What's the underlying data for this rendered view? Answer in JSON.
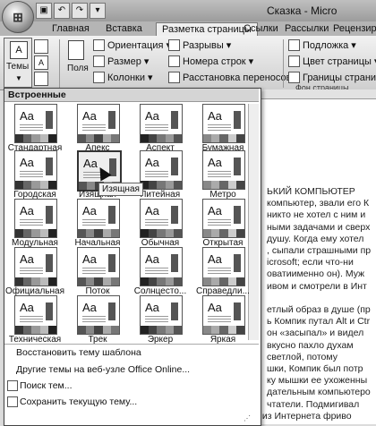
{
  "window": {
    "title": "Сказка - Micro"
  },
  "qat": {
    "items": [
      "save-icon",
      "undo-icon",
      "redo-icon",
      "customize-icon"
    ]
  },
  "tabs": [
    {
      "label": "Главная",
      "active": false
    },
    {
      "label": "Вставка",
      "active": false
    },
    {
      "label": "Разметка страницы",
      "active": true
    },
    {
      "label": "Ссылки",
      "active": false
    },
    {
      "label": "Рассылки",
      "active": false
    },
    {
      "label": "Рецензиро",
      "active": false
    }
  ],
  "ribbon": {
    "themes_label": "Темы",
    "fields_label": "Поля",
    "orientation": "Ориентация",
    "size": "Размер",
    "columns": "Колонки",
    "breaks": "Разрывы",
    "line_numbers": "Номера строк",
    "hyphenation": "Расстановка переносов",
    "watermark": "Подложка",
    "page_color": "Цвет страницы",
    "page_borders": "Границы страниц",
    "page_bg_group": "Фон страницы"
  },
  "panel": {
    "header": "Встроенные",
    "themes": [
      "Стандартная",
      "Апекс",
      "Аспект",
      "Бумажная",
      "Городская",
      "Изящная",
      "Литейная",
      "Метро",
      "Модульная",
      "Начальная",
      "Обычная",
      "Открытая",
      "Официальная",
      "Поток",
      "Солнцесто...",
      "Справедли...",
      "Техническая",
      "Трек",
      "Эркер",
      "Яркая"
    ],
    "hover_tooltip": "Изящная",
    "menu": {
      "reset": "Восстановить тему шаблона",
      "online": "Другие темы на веб-узле Office Online...",
      "search": "Поиск тем...",
      "save": "Сохранить текущую тему..."
    }
  },
  "document": {
    "lines": [
      "ЬКИЙ КОМПЬЮТЕР",
      "компьютер, звали его К",
      "никто не хотел с ним и",
      "ными задачами и сверх",
      "душу. Когда ему хотел",
      ", сыпали страшными пр",
      "icrosoft; если что-ни",
      "оватиименно он). Муж",
      "ивом и смотрели в Инт",
      "",
      "етлый образ в душе (пр",
      "ь Компик путал Alt и Ctr",
      "он «засыпал» и видел",
      "вкусно пахло духам",
      "светлой, потому",
      "шки, Компик был потр",
      "ку мышки ее ухоженны",
      "дательным компьютеро",
      "чтатели. Подмигивал",
      "лампочками, скачивал из Интернета фриво"
    ]
  }
}
